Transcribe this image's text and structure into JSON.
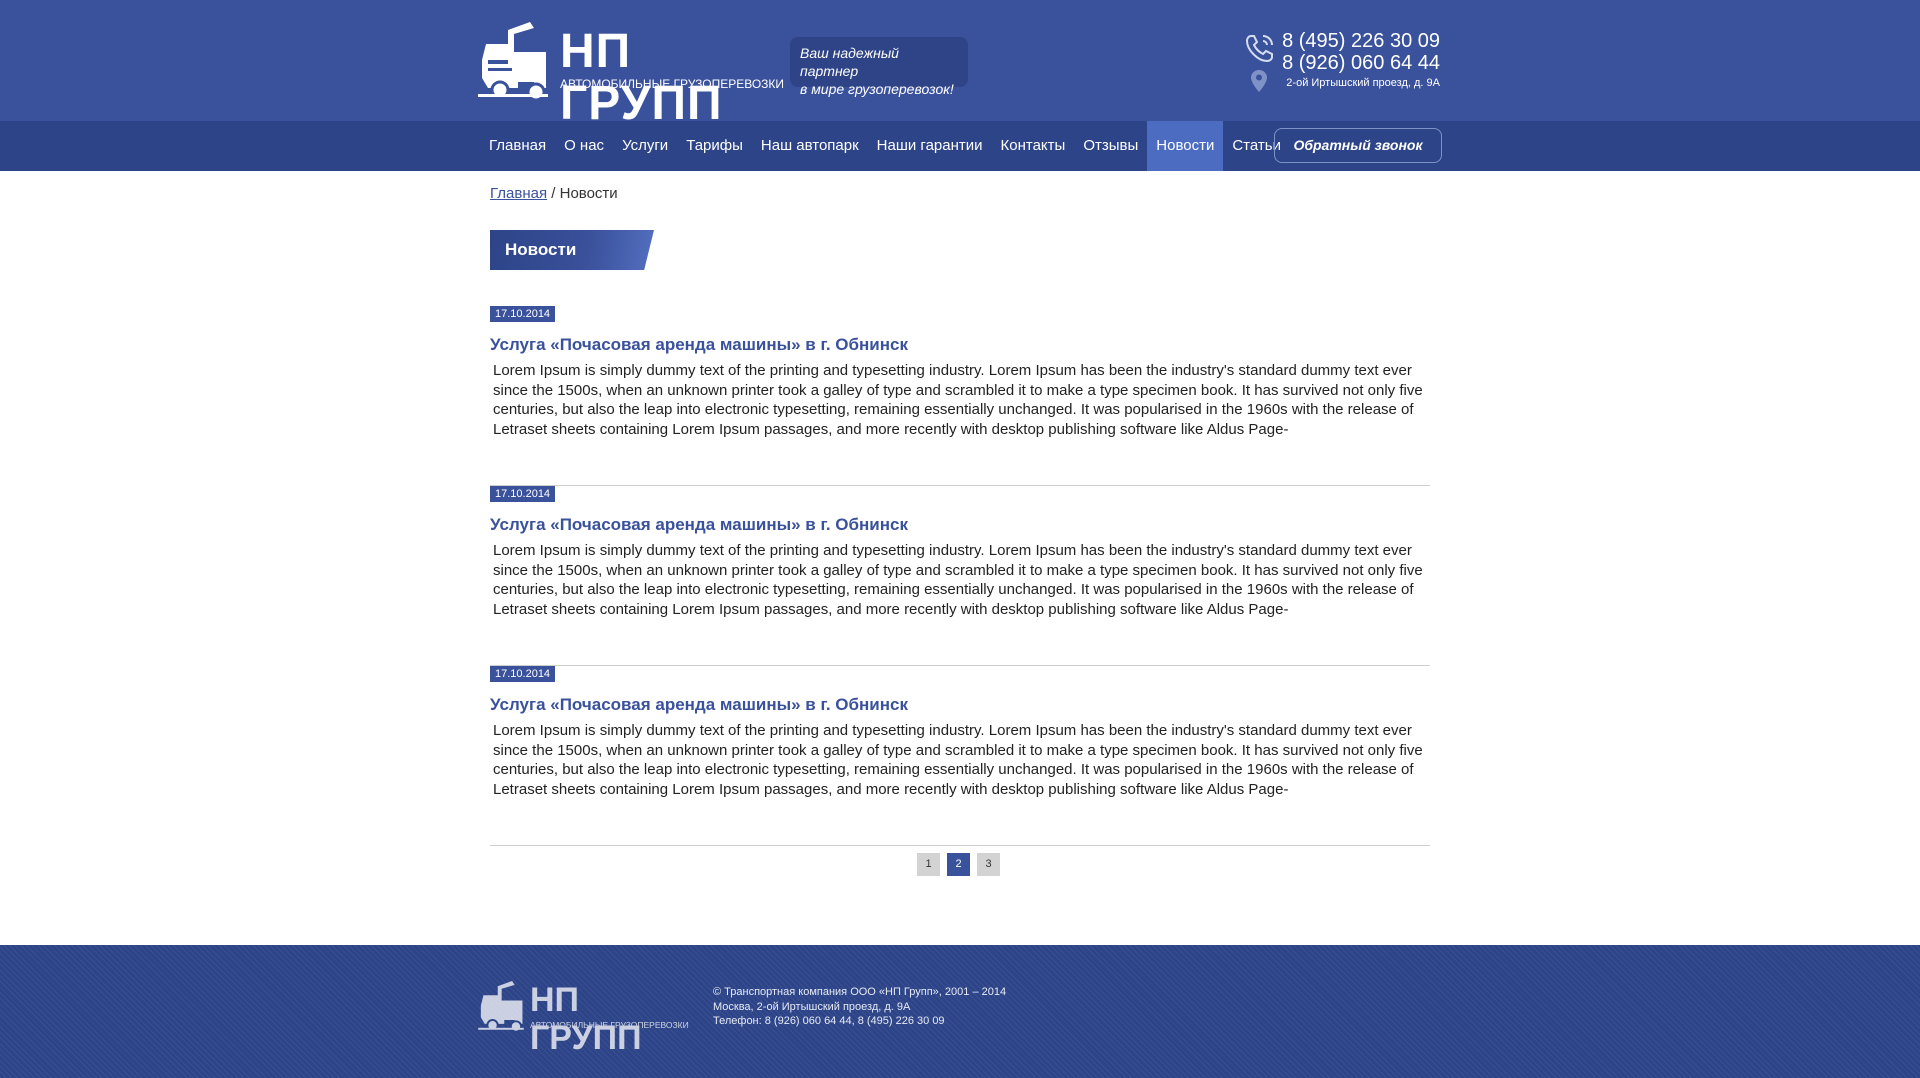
{
  "header": {
    "logo_title": "НП ГРУПП",
    "logo_subtitle": "АВТОМОБИЛЬНЫЕ ГРУЗОПЕРЕВОЗКИ",
    "slogan_line1": "Ваш надежный партнер",
    "slogan_line2": "в мире грузоперевозок!",
    "phone1": "8 (495) 226 30 09",
    "phone2": "8 (926) 060 64 44",
    "address": "2-ой Иртышский проезд, д. 9А",
    "icons": {
      "phone": "phone-icon",
      "address": "map-pin-icon",
      "logo": "truck-icon"
    }
  },
  "nav": {
    "items": [
      {
        "label": "Главная"
      },
      {
        "label": "О нас"
      },
      {
        "label": "Услуги"
      },
      {
        "label": "Тарифы"
      },
      {
        "label": "Наш автопарк"
      },
      {
        "label": "Наши гарантии"
      },
      {
        "label": "Контакты"
      },
      {
        "label": "Отзывы"
      },
      {
        "label": "Новости",
        "active": true
      },
      {
        "label": "Статьи"
      }
    ],
    "callback_label": "Обратный звонок"
  },
  "breadcrumb": {
    "home": "Главная",
    "separator": " / ",
    "current": "Новости"
  },
  "page_title": "Новости",
  "news": [
    {
      "date": "17.10.2014",
      "title": "Услуга «Почасовая аренда машины» в г. Обнинск",
      "text": "Lorem Ipsum is simply dummy text of the printing and typesetting industry. Lorem Ipsum has been the industry's standard dummy text ever since the 1500s, when an unknown printer took a galley of type and scrambled it to make a type specimen book. It has survived not only five centuries, but also the leap into electronic typesetting, remaining essentially unchanged. It was popularised in the 1960s with the release of Letraset sheets containing Lorem Ipsum passages, and more recently with desktop publishing software like Aldus Page-"
    },
    {
      "date": "17.10.2014",
      "title": "Услуга «Почасовая аренда машины» в г. Обнинск",
      "text": "Lorem Ipsum is simply dummy text of the printing and typesetting industry. Lorem Ipsum has been the industry's standard dummy text ever since the 1500s, when an unknown printer took a galley of type and scrambled it to make a type specimen book. It has survived not only five centuries, but also the leap into electronic typesetting, remaining essentially unchanged. It was popularised in the 1960s with the release of Letraset sheets containing Lorem Ipsum passages, and more recently with desktop publishing software like Aldus Page-"
    },
    {
      "date": "17.10.2014",
      "title": "Услуга «Почасовая аренда машины» в г. Обнинск",
      "text": "Lorem Ipsum is simply dummy text of the printing and typesetting industry. Lorem Ipsum has been the industry's standard dummy text ever since the 1500s, when an unknown printer took a galley of type and scrambled it to make a type specimen book. It has survived not only five centuries, but also the leap into electronic typesetting, remaining essentially unchanged. It was popularised in the 1960s with the release of Letraset sheets containing Lorem Ipsum passages, and more recently with desktop publishing software like Aldus Page-"
    }
  ],
  "pagination": {
    "pages": [
      "1",
      "2",
      "3"
    ],
    "current": "2"
  },
  "footer": {
    "logo_title": "НП ГРУПП",
    "logo_subtitle": "АВТОМОБИЛЬНЫЕ ГРУЗОПЕРЕВОЗКИ",
    "line1": "© Транспортная компания ООО «НП Групп», 2001 – 2014",
    "line2": "Москва, 2-ой Иртышский проезд, д. 9А",
    "line3": "Телефон: 8 (926) 060 64 44,  8 (495) 226 30 09"
  },
  "colors": {
    "header_bg": "#3a519b",
    "nav_bg": "#2d4488",
    "nav_active": "#4b6cc0",
    "accent": "#3a519b",
    "footer_bg": "#2d4488"
  }
}
